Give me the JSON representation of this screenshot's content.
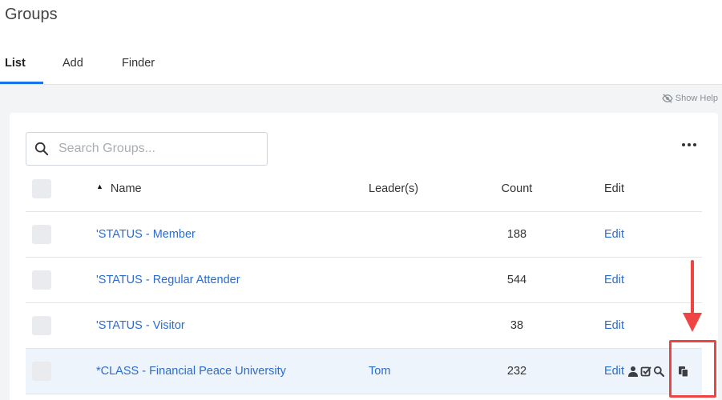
{
  "page": {
    "title": "Groups"
  },
  "tabs": [
    {
      "label": "List",
      "active": true
    },
    {
      "label": "Add",
      "active": false
    },
    {
      "label": "Finder",
      "active": false
    }
  ],
  "help": {
    "label": "Show Help",
    "icon": "eye-slash-icon"
  },
  "search": {
    "placeholder": "Search Groups...",
    "value": "",
    "icon": "search-icon"
  },
  "table": {
    "columns": {
      "name": "Name",
      "leaders": "Leader(s)",
      "count": "Count",
      "edit": "Edit"
    },
    "sort": {
      "column": "Name",
      "direction": "ascending"
    },
    "rows": [
      {
        "name": "'STATUS - Member",
        "leader": "",
        "count": "188",
        "edit": "Edit"
      },
      {
        "name": "'STATUS - Regular Attender",
        "leader": "",
        "count": "544",
        "edit": "Edit"
      },
      {
        "name": "'STATUS - Visitor",
        "leader": "",
        "count": "38",
        "edit": "Edit"
      },
      {
        "name": "*CLASS - Financial Peace University",
        "leader": "Tom",
        "count": "232",
        "edit": "Edit"
      }
    ]
  },
  "colors": {
    "accent": "#1a73e8",
    "link": "#2a6cd0",
    "highlight_row": "#eef4fb",
    "annotation": "#ef4444",
    "background": "#f3f4f6"
  }
}
